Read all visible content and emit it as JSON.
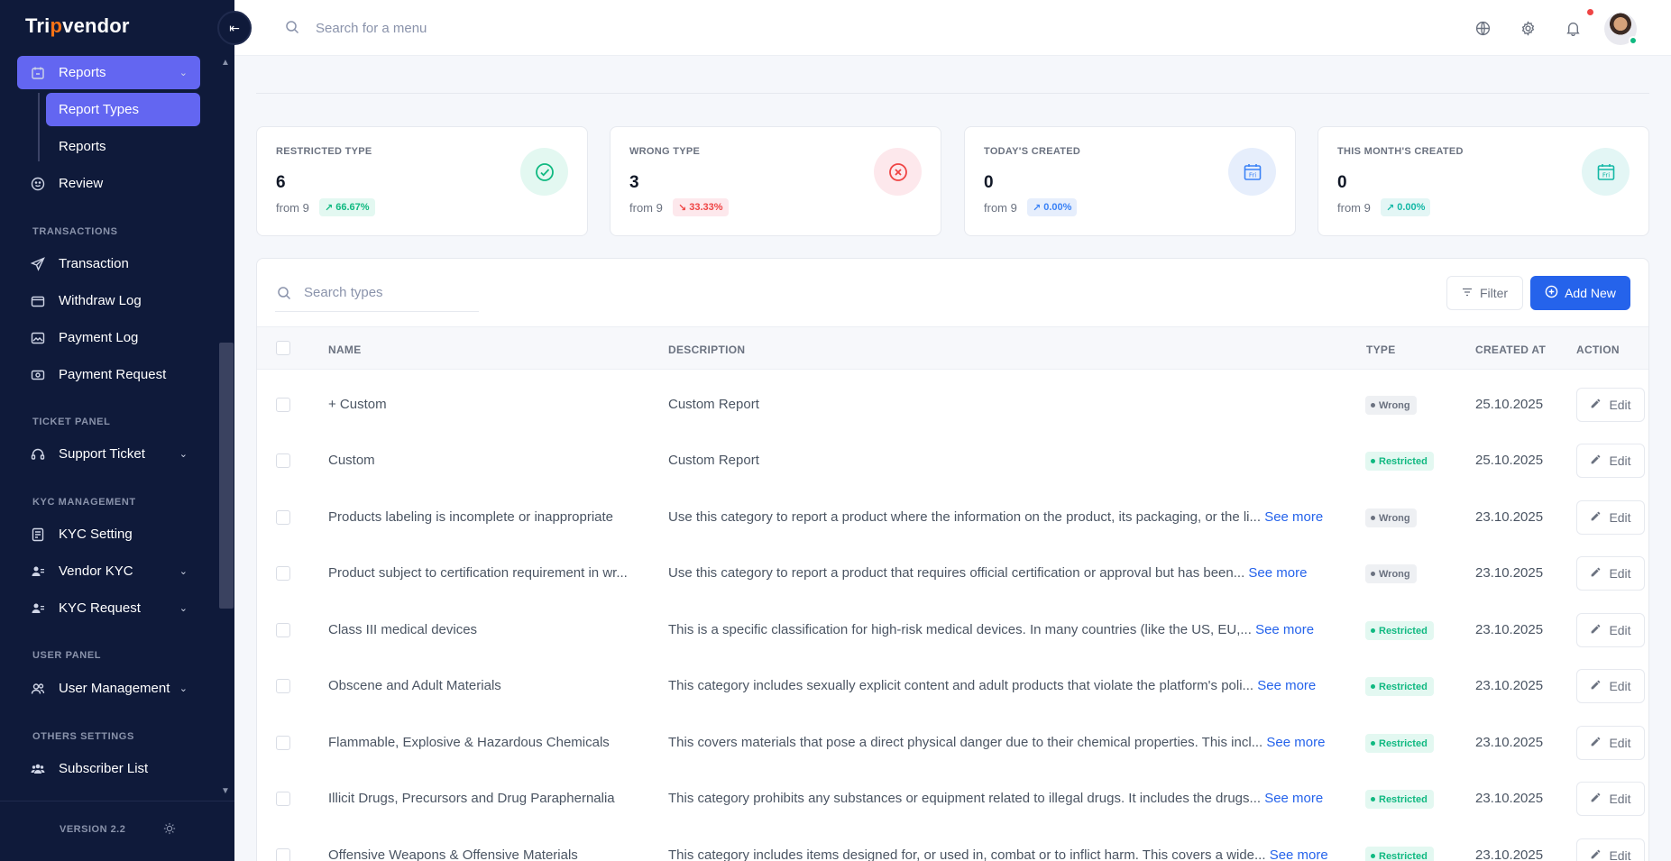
{
  "app": {
    "logo_text_a": "Tri",
    "logo_text_dot": "p",
    "logo_text_b": "vendor"
  },
  "topbar": {
    "search_placeholder": "Search for a menu"
  },
  "sidebar": {
    "reports_group": "Reports",
    "sub_items": [
      "Report Types",
      "Reports"
    ],
    "review": "Review",
    "sections": {
      "transactions": "TRANSACTIONS",
      "ticket_panel": "TICKET PANEL",
      "kyc_management": "KYC MANAGEMENT",
      "user_panel": "USER PANEL",
      "others_settings": "OTHERS SETTINGS"
    },
    "transaction": "Transaction",
    "withdraw_log": "Withdraw Log",
    "payment_log": "Payment Log",
    "payment_request": "Payment Request",
    "support_ticket": "Support Ticket",
    "kyc_setting": "KYC Setting",
    "vendor_kyc": "Vendor KYC",
    "kyc_request": "KYC Request",
    "user_management": "User Management",
    "subscriber_list": "Subscriber List",
    "version": "VERSION 2.2"
  },
  "stats": [
    {
      "label": "RESTRICTED TYPE",
      "value": "6",
      "from": "from 9",
      "pct": "66.67%",
      "color": "#10b981",
      "bg": "#e3f8f1"
    },
    {
      "label": "WRONG TYPE",
      "value": "3",
      "from": "from 9",
      "pct": "33.33%",
      "color": "#ef4444",
      "bg": "#fde8ec"
    },
    {
      "label": "TODAY'S CREATED",
      "value": "0",
      "from": "from 9",
      "pct": "0.00%",
      "color": "#3b82f6",
      "bg": "#e6eefc",
      "icon_text": "Fri"
    },
    {
      "label": "THIS MONTH'S CREATED",
      "value": "0",
      "from": "from 9",
      "pct": "0.00%",
      "color": "#14b8a6",
      "bg": "#e3f6f5",
      "icon_text": "Fri"
    }
  ],
  "table": {
    "search_placeholder": "Search types",
    "filter_label": "Filter",
    "add_label": "Add New",
    "columns": [
      "NAME",
      "DESCRIPTION",
      "TYPE",
      "CREATED AT",
      "ACTION"
    ],
    "edit_label": "Edit",
    "see_more": "See more",
    "rows": [
      {
        "name": "+ Custom",
        "description": "Custom Report",
        "type": "Wrong",
        "created": "25.10.2025"
      },
      {
        "name": "Custom",
        "description": "Custom Report",
        "type": "Restricted",
        "created": "25.10.2025"
      },
      {
        "name": "Products labeling is incomplete or inappropriate",
        "description": "Use this category to report a product where the information on the product, its packaging, or the li...",
        "type": "Wrong",
        "created": "23.10.2025"
      },
      {
        "name": "Product subject to certification requirement in wr...",
        "description": "Use this category to report a product that requires official certification or approval but has been...",
        "type": "Wrong",
        "created": "23.10.2025"
      },
      {
        "name": "Class III medical devices",
        "description": "This is a specific classification for high-risk medical devices. In many countries (like the US, EU,...",
        "type": "Restricted",
        "created": "23.10.2025"
      },
      {
        "name": "Obscene and Adult Materials",
        "description": "This category includes sexually explicit content and adult products that violate the platform's poli...",
        "type": "Restricted",
        "created": "23.10.2025"
      },
      {
        "name": "Flammable, Explosive & Hazardous Chemicals",
        "description": "This covers materials that pose a direct physical danger due to their chemical properties. This incl...",
        "type": "Restricted",
        "created": "23.10.2025"
      },
      {
        "name": "Illicit Drugs, Precursors and Drug Paraphernalia",
        "description": "This category prohibits any substances or equipment related to illegal drugs. It includes the drugs...",
        "type": "Restricted",
        "created": "23.10.2025"
      },
      {
        "name": "Offensive Weapons & Offensive Materials",
        "description": "This category includes items designed for, or used in, combat or to inflict harm. This covers a wide...",
        "type": "Restricted",
        "created": "23.10.2025"
      }
    ]
  }
}
